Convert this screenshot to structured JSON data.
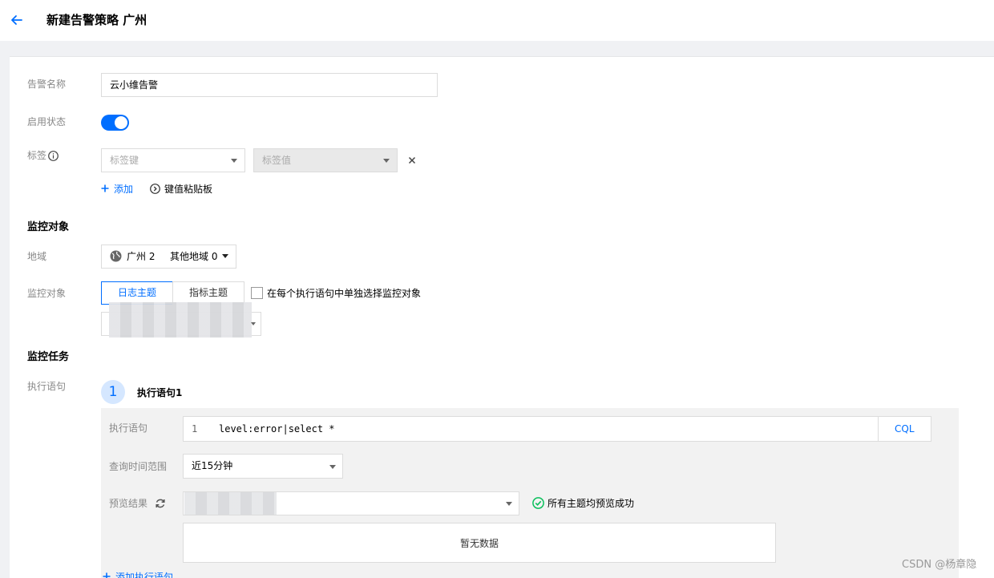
{
  "header": {
    "title": "新建告警策略 广州"
  },
  "basic": {
    "name_label": "告警名称",
    "name_value": "云小维告警",
    "status_label": "启用状态",
    "status_on": true,
    "tag_label": "标签",
    "tag_key_placeholder": "标签键",
    "tag_value_placeholder": "标签值",
    "add_label": "添加",
    "clipboard_label": "键值粘贴板"
  },
  "monitor_object": {
    "section_title": "监控对象",
    "region_label": "地域",
    "region_value": "广州 2",
    "other_region": "其他地域 0",
    "object_label": "监控对象",
    "tabs": [
      "日志主题",
      "指标主题"
    ],
    "active_tab": 0,
    "checkbox_label": "在每个执行语句中单独选择监控对象",
    "checkbox_checked": false
  },
  "monitor_task": {
    "section_title": "监控任务",
    "statement_label": "执行语句",
    "step_number": "1",
    "step_title": "执行语句1",
    "code_label": "执行语句",
    "code_line_no": "1",
    "code_text": "level:error|select *",
    "cql_label": "CQL",
    "time_range_label": "查询时间范围",
    "time_range_value": "近15分钟",
    "preview_label": "预览结果",
    "preview_status": "所有主题均预览成功",
    "empty_text": "暂无数据",
    "add_statement_label": "添加执行语句"
  },
  "watermark": "CSDN @杨章隐",
  "colors": {
    "accent": "#006eff",
    "success": "#0abf5b"
  }
}
